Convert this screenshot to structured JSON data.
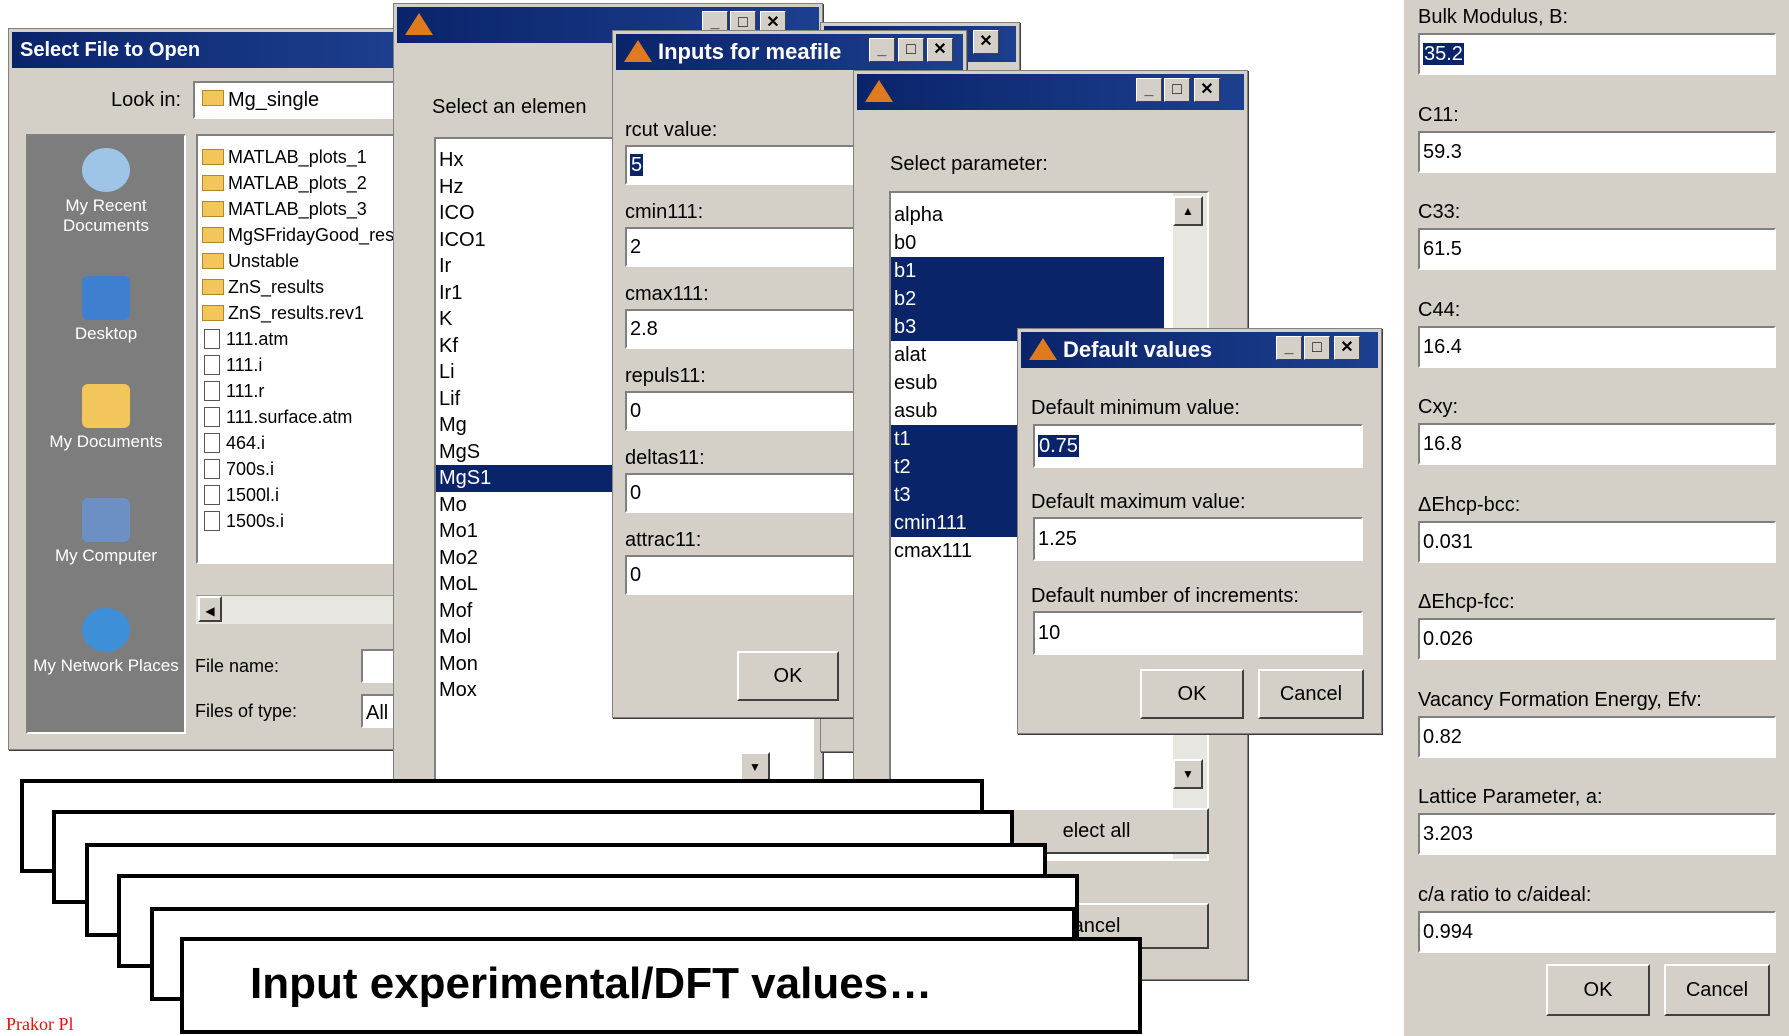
{
  "open_dialog": {
    "title": "Select File to Open",
    "look_in_label": "Look in:",
    "look_in_value": "Mg_single",
    "places": [
      "My Recent Documents",
      "Desktop",
      "My Documents",
      "My Computer",
      "My Network Places"
    ],
    "files": [
      {
        "name": "MATLAB_plots_1",
        "type": "folder"
      },
      {
        "name": "MATLAB_plots_2",
        "type": "folder"
      },
      {
        "name": "MATLAB_plots_3",
        "type": "folder"
      },
      {
        "name": "MgSFridayGood_res",
        "type": "folder"
      },
      {
        "name": "Unstable",
        "type": "folder"
      },
      {
        "name": "ZnS_results",
        "type": "folder"
      },
      {
        "name": "ZnS_results.rev1",
        "type": "folder"
      },
      {
        "name": "111.atm",
        "type": "file"
      },
      {
        "name": "111.i",
        "type": "file"
      },
      {
        "name": "111.r",
        "type": "file"
      },
      {
        "name": "111.surface.atm",
        "type": "file"
      },
      {
        "name": "464.i",
        "type": "file"
      },
      {
        "name": "700s.i",
        "type": "file"
      },
      {
        "name": "1500l.i",
        "type": "file"
      },
      {
        "name": "1500s.i",
        "type": "file"
      }
    ],
    "file_name_label": "File name:",
    "files_of_type_label": "Files of type:",
    "files_of_type_value": "All"
  },
  "element_dialog": {
    "prompt": "Select an elemen",
    "elements": [
      "Hx",
      "Hz",
      "ICO",
      "ICO1",
      "Ir",
      "Ir1",
      "K",
      "Kf",
      "Li",
      "Lif",
      "Mg",
      "MgS",
      "MgS1",
      "Mo",
      "Mo1",
      "Mo2",
      "MoL",
      "Mof",
      "Mol",
      "Mon",
      "Mox"
    ],
    "selected": "MgS1"
  },
  "meafile_dialog": {
    "title": "Inputs for meafile",
    "fields": [
      {
        "label": "rcut value:",
        "value": "5"
      },
      {
        "label": "cmin111:",
        "value": "2"
      },
      {
        "label": "cmax111:",
        "value": "2.8"
      },
      {
        "label": "repuls11:",
        "value": "0"
      },
      {
        "label": "deltas11:",
        "value": "0"
      },
      {
        "label": "attrac11:",
        "value": "0"
      }
    ],
    "ok_label": "OK"
  },
  "parameter_dialog": {
    "prompt": "Select parameter:",
    "params": [
      {
        "name": "alpha",
        "selected": false
      },
      {
        "name": "b0",
        "selected": false
      },
      {
        "name": "b1",
        "selected": true
      },
      {
        "name": "b2",
        "selected": true
      },
      {
        "name": "b3",
        "selected": true
      },
      {
        "name": "alat",
        "selected": false
      },
      {
        "name": "esub",
        "selected": false
      },
      {
        "name": "asub",
        "selected": false
      },
      {
        "name": "t1",
        "selected": true
      },
      {
        "name": "t2",
        "selected": true
      },
      {
        "name": "t3",
        "selected": true
      },
      {
        "name": "cmin111",
        "selected": true
      },
      {
        "name": "cmax111",
        "selected": false
      }
    ],
    "select_all_label": "elect all",
    "cancel_label": "ancel"
  },
  "defaults_dialog": {
    "title": "Default values",
    "min_label": "Default minimum value:",
    "min_value": "0.75",
    "max_label": "Default maximum value:",
    "max_value": "1.25",
    "inc_label": "Default number of increments:",
    "inc_value": "10",
    "ok_label": "OK",
    "cancel_label": "Cancel"
  },
  "properties_dialog": {
    "fields": [
      {
        "label": "Bulk Modulus, B:",
        "value": "35.2"
      },
      {
        "label": "C11:",
        "value": "59.3"
      },
      {
        "label": "C33:",
        "value": "61.5"
      },
      {
        "label": "C44:",
        "value": "16.4"
      },
      {
        "label": "Cxy:",
        "value": "16.8"
      },
      {
        "label": "ΔEhcp-bcc:",
        "value": "0.031"
      },
      {
        "label": "ΔEhcp-fcc:",
        "value": "0.026"
      },
      {
        "label": "Vacancy Formation Energy, Efv:",
        "value": "0.82"
      },
      {
        "label": "Lattice Parameter, a:",
        "value": "3.203"
      },
      {
        "label": "c/a ratio to c/aideal:",
        "value": "0.994"
      }
    ],
    "ok_label": "OK",
    "cancel_label": "Cancel"
  },
  "overlay": {
    "front_card_text": "Input experimental/DFT values…",
    "footer_text": "Prakor Pl"
  }
}
